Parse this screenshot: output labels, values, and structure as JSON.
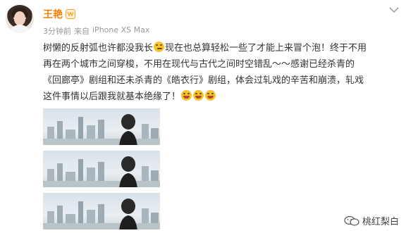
{
  "user": {
    "name": "王艳",
    "badge_icon": "vip-crown-icon"
  },
  "meta": {
    "time": "3分钟前",
    "source_prefix": "来自",
    "source": "iPhone XS Max"
  },
  "content": {
    "line1_a": "树懒的反射弧也许都没我长",
    "line1_b": "现在也总算轻松一些了才能上来冒个泡！终于不用",
    "line2": "再在两个城市之间穿梭，不用在现代与古代之间时空错乱～～感谢已经杀青的",
    "line3": "《回廊亭》剧组和还未杀青的《皓衣行》剧组，体会过轧戏的辛苦和崩溃，轧戏",
    "line4": "这件事情以后跟我就基本绝缘了！"
  },
  "images": [
    {
      "description": "photo-1"
    },
    {
      "description": "photo-2"
    },
    {
      "description": "photo-3"
    }
  ],
  "watermark": {
    "text": "桃红梨白",
    "icon": "wechat-icon"
  },
  "colors": {
    "name": "#ff7b00",
    "meta": "#999999",
    "text": "#333333"
  }
}
